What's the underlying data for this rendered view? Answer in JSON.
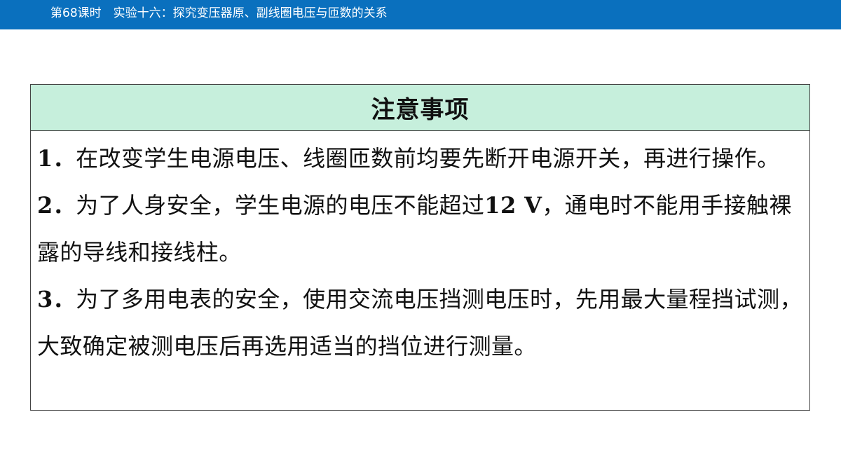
{
  "header": {
    "title": "第68课时　实验十六：探究变压器原、副线圈电压与匝数的关系"
  },
  "notice": {
    "title": "注意事项",
    "items": [
      {
        "num": "1．",
        "text": "在改变学生电源电压、线圈匝数前均要先断开电源开关，再进行操作。"
      },
      {
        "num": "2．",
        "text_before": "为了人身安全，学生电源的电压不能超过",
        "bold_value": "12 V",
        "text_after": "，通电时不能用手接触裸露的导线和接线柱。"
      },
      {
        "num": "3．",
        "text": "为了多用电表的安全，使用交流电压挡测电压时，先用最大量程挡试测，大致确定被测电压后再选用适当的挡位进行测量。"
      }
    ]
  }
}
